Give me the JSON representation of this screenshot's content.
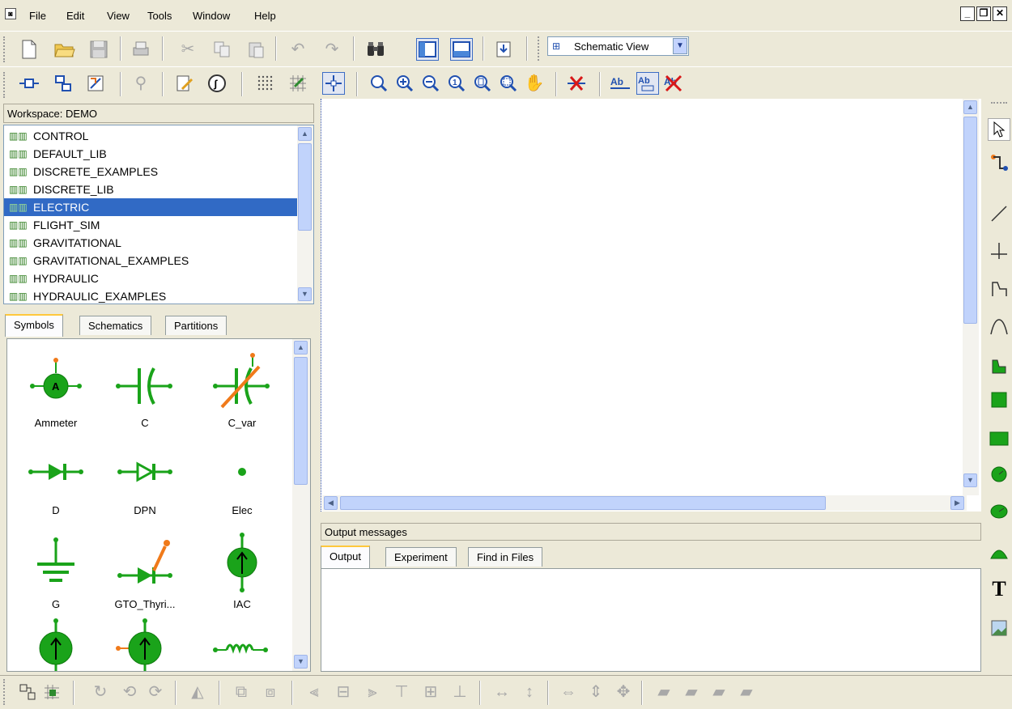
{
  "menu": {
    "items": [
      "File",
      "Edit",
      "View",
      "Tools",
      "Window",
      "Help"
    ]
  },
  "window_controls": {
    "minimize": "_",
    "restore": "❐",
    "close": "✕"
  },
  "toolbar": {
    "view_select": "Schematic View"
  },
  "workspace": {
    "header": "Workspace: DEMO",
    "libraries": [
      "CONTROL",
      "DEFAULT_LIB",
      "DISCRETE_EXAMPLES",
      "DISCRETE_LIB",
      "ELECTRIC",
      "FLIGHT_SIM",
      "GRAVITATIONAL",
      "GRAVITATIONAL_EXAMPLES",
      "HYDRAULIC",
      "HYDRAULIC_EXAMPLES"
    ],
    "selected_library": "ELECTRIC"
  },
  "symbol_tabs": [
    "Symbols",
    "Schematics",
    "Partitions"
  ],
  "symbols": [
    "Ammeter",
    "C",
    "C_var",
    "D",
    "DPN",
    "Elec",
    "G",
    "GTO_Thyri...",
    "IAC",
    "",
    "",
    ""
  ],
  "output": {
    "header": "Output messages",
    "tabs": [
      "Output",
      "Experiment",
      "Find in Files"
    ]
  },
  "colors": {
    "symbol_green": "#1aa31a",
    "accent_orange": "#f07a1a",
    "selection_blue": "#316ac5"
  }
}
